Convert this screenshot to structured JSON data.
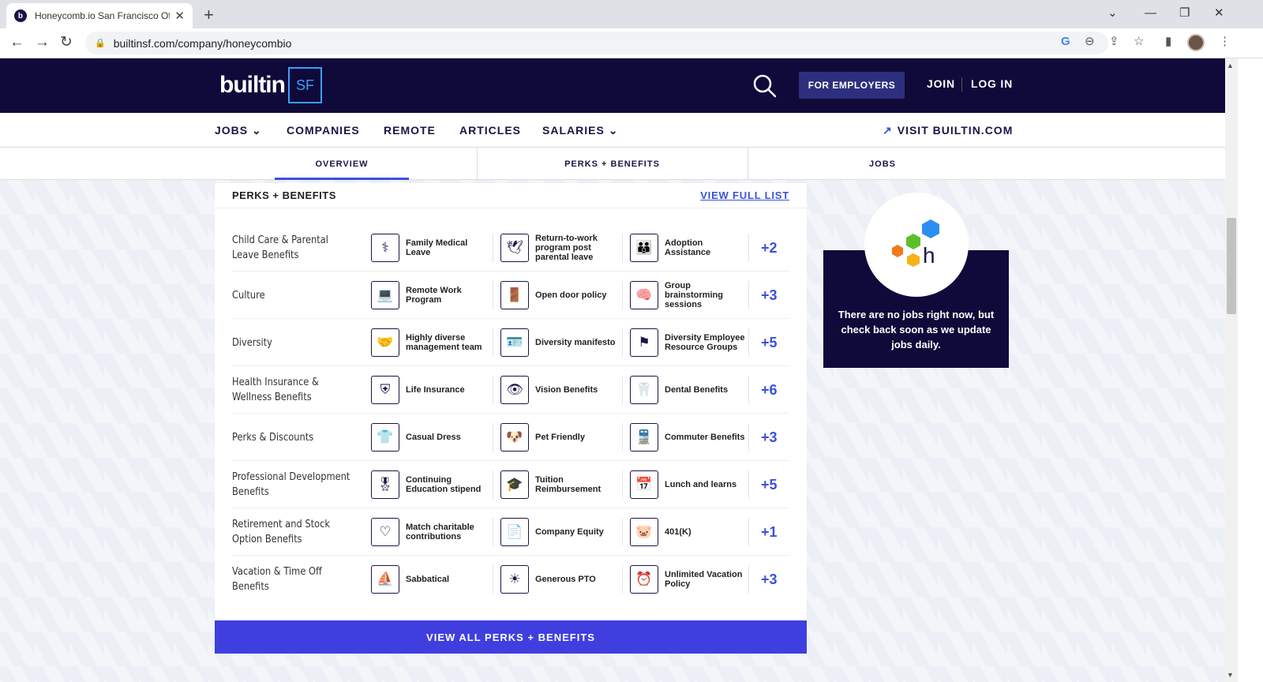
{
  "browser": {
    "tab_title": "Honeycomb.io San Francisco Offi",
    "favicon_letter": "b",
    "url": "builtinsf.com/company/honeycombio"
  },
  "header": {
    "logo_text": "builtin",
    "logo_city": "SF",
    "employers_label": "FOR EMPLOYERS",
    "join_label": "JOIN",
    "login_label": "LOG IN"
  },
  "nav": {
    "jobs": "JOBS",
    "companies": "COMPANIES",
    "remote": "REMOTE",
    "articles": "ARTICLES",
    "salaries": "SALARIES",
    "visit": "VISIT BUILTIN.COM"
  },
  "subtabs": {
    "overview": "OVERVIEW",
    "perks": "PERKS + BENEFITS",
    "jobs": "JOBS"
  },
  "perks_card": {
    "title": "PERKS + BENEFITS",
    "view_full": "VIEW FULL LIST",
    "view_all": "VIEW ALL PERKS + BENEFITS",
    "rows": [
      {
        "category": "Child Care & Parental Leave Benefits",
        "perks": [
          "Family Medical Leave",
          "Return-to-work program post parental leave",
          "Adoption Assistance"
        ],
        "more": "+2"
      },
      {
        "category": "Culture",
        "perks": [
          "Remote Work Program",
          "Open door policy",
          "Group brainstorming sessions"
        ],
        "more": "+3"
      },
      {
        "category": "Diversity",
        "perks": [
          "Highly diverse management team",
          "Diversity manifesto",
          "Diversity Employee Resource Groups"
        ],
        "more": "+5"
      },
      {
        "category": "Health Insurance & Wellness Benefits",
        "perks": [
          "Life Insurance",
          "Vision Benefits",
          "Dental Benefits"
        ],
        "more": "+6"
      },
      {
        "category": "Perks & Discounts",
        "perks": [
          "Casual Dress",
          "Pet Friendly",
          "Commuter Benefits"
        ],
        "more": "+3"
      },
      {
        "category": "Professional Development Benefits",
        "perks": [
          "Continuing Education stipend",
          "Tuition Reimbursement",
          "Lunch and learns"
        ],
        "more": "+5"
      },
      {
        "category": "Retirement and Stock Option Benefits",
        "perks": [
          "Match charitable contributions",
          "Company Equity",
          "401(K)"
        ],
        "more": "+1"
      },
      {
        "category": "Vacation & Time Off Benefits",
        "perks": [
          "Sabbatical",
          "Generous PTO",
          "Unlimited Vacation Policy"
        ],
        "more": "+3"
      }
    ]
  },
  "jobs_card": {
    "message": "There are no jobs right now, but check back soon as we update jobs daily."
  },
  "colors": {
    "brand_navy": "#0f0a3a",
    "accent_blue": "#3b50e0",
    "honeycomb_blue": "#2c8ef0",
    "honeycomb_green": "#5cbf2a",
    "honeycomb_orange": "#f07a1a",
    "honeycomb_yellow": "#f5b318"
  }
}
